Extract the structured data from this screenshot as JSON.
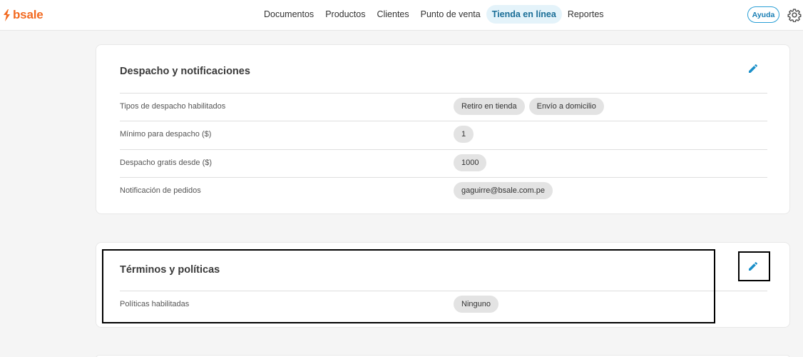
{
  "brand": {
    "name": "bsale",
    "color": "#f26a21"
  },
  "nav": {
    "items": [
      {
        "label": "Documentos",
        "active": false
      },
      {
        "label": "Productos",
        "active": false
      },
      {
        "label": "Clientes",
        "active": false
      },
      {
        "label": "Punto de venta",
        "active": false
      },
      {
        "label": "Tienda en línea",
        "active": true
      },
      {
        "label": "Reportes",
        "active": false
      }
    ]
  },
  "header": {
    "help_label": "Ayuda",
    "settings_icon": "gear-icon"
  },
  "dispatch": {
    "title": "Despacho y notificaciones",
    "edit_icon": "pencil-icon",
    "rows": [
      {
        "label": "Tipos de despacho habilitados",
        "values": [
          "Retiro en tienda",
          "Envío a domicilio"
        ]
      },
      {
        "label": "Mínimo para despacho ($)",
        "values": [
          "1"
        ]
      },
      {
        "label": "Despacho gratis desde ($)",
        "values": [
          "1000"
        ]
      },
      {
        "label": "Notificación de pedidos",
        "values": [
          "gaguirre@bsale.com.pe"
        ]
      }
    ]
  },
  "terms": {
    "title": "Términos y políticas",
    "edit_icon": "pencil-icon",
    "rows": [
      {
        "label": "Políticas habilitadas",
        "values": [
          "Ninguno"
        ]
      }
    ]
  },
  "colors": {
    "accent": "#2a9fd6",
    "active_nav_bg": "#e4f3fa",
    "chip_bg": "#e3e3e3"
  }
}
